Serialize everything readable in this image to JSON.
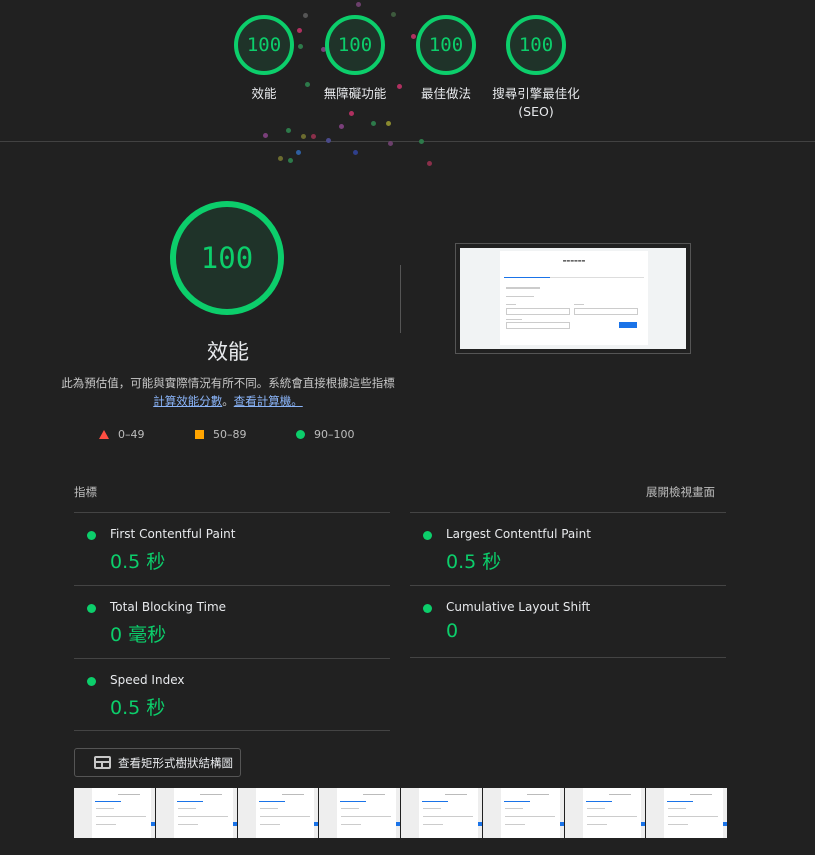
{
  "categories": [
    {
      "score": "100",
      "label": "效能"
    },
    {
      "score": "100",
      "label": "無障礙功能"
    },
    {
      "score": "100",
      "label": "最佳做法"
    },
    {
      "score": "100",
      "label": "搜尋引擎最佳化\n(SEO)"
    }
  ],
  "performance": {
    "score": "100",
    "title": "效能",
    "desc_text": "此為預估值，可能與實際情況有所不同。系統會直接根據這些指標",
    "link1": "計算效能分數",
    "sep": "。",
    "link2": "查看計算機。"
  },
  "legend": {
    "fail": "0–49",
    "average": "50–89",
    "pass": "90–100"
  },
  "metrics_header": {
    "left": "指標",
    "right": "展開檢視畫面"
  },
  "metrics": {
    "fcp": {
      "label": "First Contentful Paint",
      "value": "0.5 秒"
    },
    "lcp": {
      "label": "Largest Contentful Paint",
      "value": "0.5 秒"
    },
    "tbt": {
      "label": "Total Blocking Time",
      "value": "0 毫秒"
    },
    "cls": {
      "label": "Cumulative Layout Shift",
      "value": "0"
    },
    "si": {
      "label": "Speed Index",
      "value": "0.5 秒"
    }
  },
  "treemap_button": "查看矩形式樹狀結構圖",
  "colors": {
    "pass": "#0cce6b",
    "average": "#ffa400",
    "fail": "#ff4e42",
    "link": "#8ab4f8"
  },
  "icons": {
    "treemap": "treemap-icon"
  }
}
